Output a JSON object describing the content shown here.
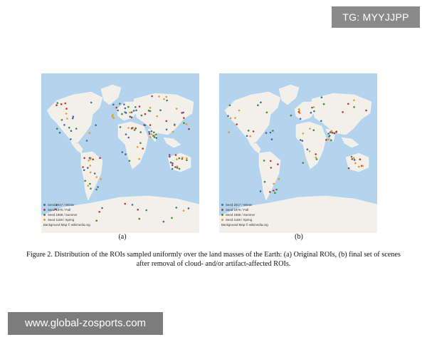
{
  "watermarks": {
    "top_right": "TG: MYYJJPP",
    "bottom_left": "www.global-zosports.com"
  },
  "legend": {
    "items": [
      {
        "label": "Seed 2017 / Winter",
        "color": "#3a6ea5"
      },
      {
        "label": "Seed 1970 / Fall",
        "color": "#c8322d"
      },
      {
        "label": "Seed 1868 / Summer",
        "color": "#3d8b3d"
      },
      {
        "label": "Seed 1158 / Spring",
        "color": "#e39a2c"
      }
    ],
    "credit": "Background Map © wikimedia.org"
  },
  "panels": [
    {
      "label": "(a)"
    },
    {
      "label": "(b)"
    }
  ],
  "caption": "Figure 2. Distribution of the ROIs sampled uniformly over the land masses of the Earth: (a) Original ROIs, (b) final set of scenes after removal of cloud- and/or artifact-affected ROIs.",
  "colors": {
    "ocean": "#b4d3ec",
    "land": "#f3f0ea",
    "border": "#ffffff"
  }
}
